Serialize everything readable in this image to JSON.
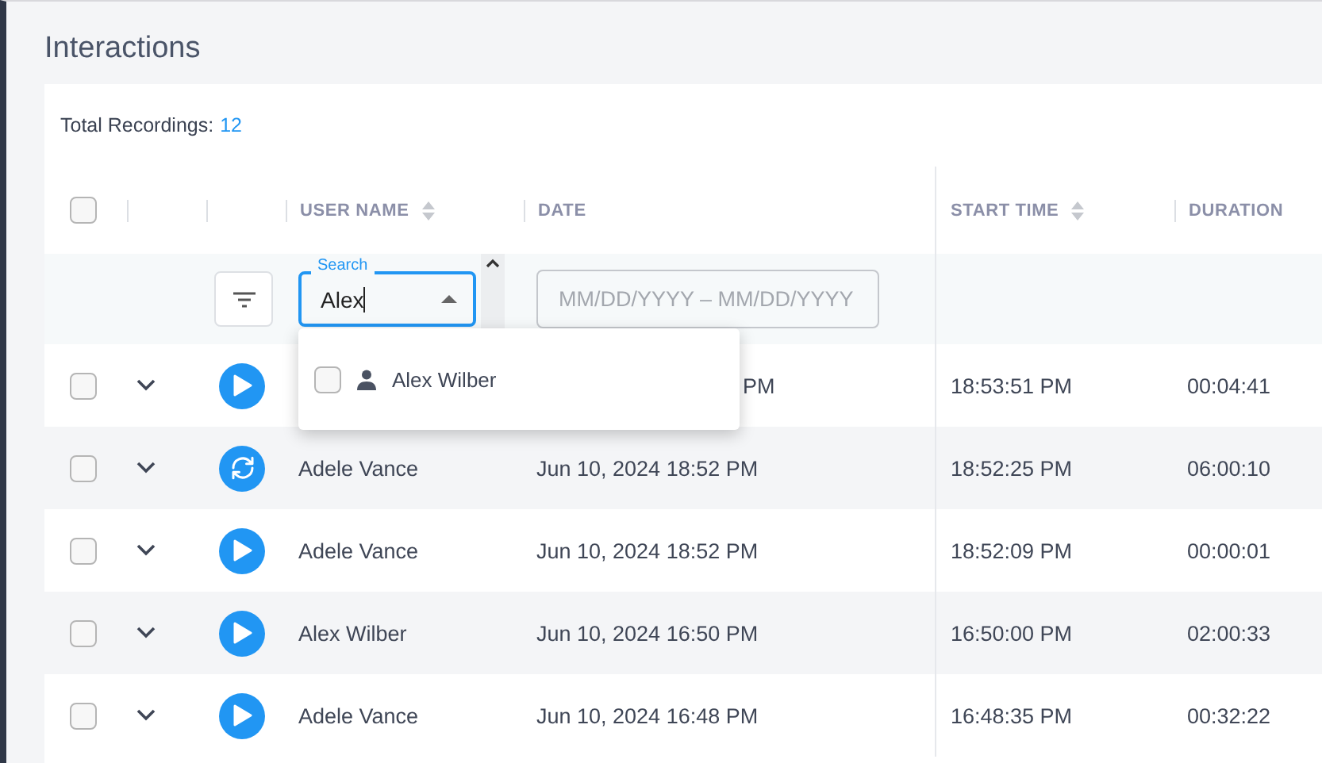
{
  "page": {
    "title": "Interactions"
  },
  "summary": {
    "label": "Total Recordings:",
    "count": "12"
  },
  "header": {
    "select_all_checked": false,
    "columns": [
      {
        "label": "USER NAME",
        "sortable": true
      },
      {
        "label": "DATE",
        "sortable": false
      },
      {
        "label": "START TIME",
        "sortable": true
      },
      {
        "label": "DURATION",
        "sortable": false
      }
    ]
  },
  "filters": {
    "search": {
      "label": "Search",
      "value": "Alex",
      "open": true
    },
    "date": {
      "placeholder": "MM/DD/YYYY – MM/DD/YYYY"
    }
  },
  "dropdown": {
    "options": [
      {
        "label": "Alex Wilber",
        "checked": false
      }
    ]
  },
  "rows": [
    {
      "checked": false,
      "expanded": false,
      "kind": "play",
      "date": "PM",
      "start_time": "18:53:51 PM",
      "duration": "00:04:41"
    },
    {
      "checked": false,
      "expanded": false,
      "kind": "sync",
      "user_name": "Adele Vance",
      "date": "Jun 10, 2024 18:52 PM",
      "start_time": "18:52:25 PM",
      "duration": "06:00:10"
    },
    {
      "checked": false,
      "expanded": false,
      "kind": "play",
      "user_name": "Adele Vance",
      "date": "Jun 10, 2024 18:52 PM",
      "start_time": "18:52:09 PM",
      "duration": "00:00:01"
    },
    {
      "checked": false,
      "expanded": false,
      "kind": "play",
      "user_name": "Alex Wilber",
      "date": "Jun 10, 2024 16:50 PM",
      "start_time": "16:50:00 PM",
      "duration": "02:00:33"
    },
    {
      "checked": false,
      "expanded": false,
      "kind": "play",
      "user_name": "Adele Vance",
      "date": "Jun 10, 2024 16:48 PM",
      "start_time": "16:48:35 PM",
      "duration": "00:32:22"
    }
  ]
}
